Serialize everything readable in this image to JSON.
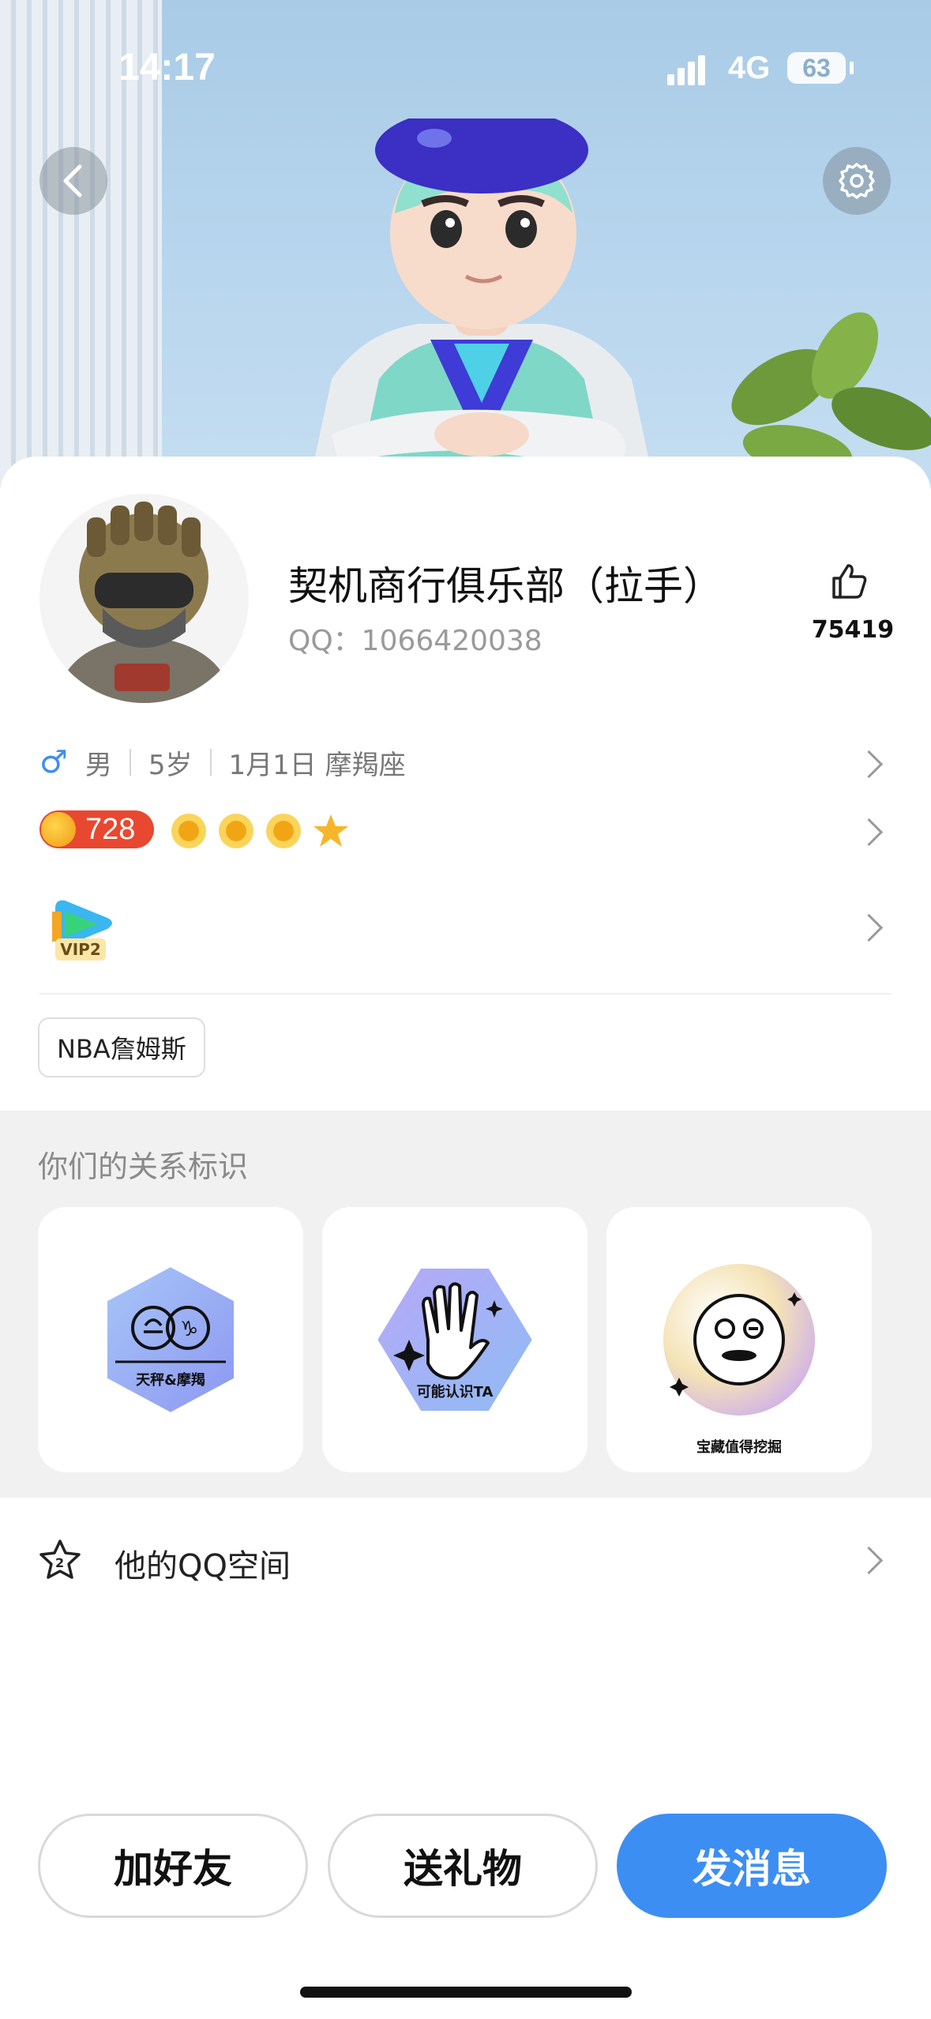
{
  "status_bar": {
    "time": "14:17",
    "network": "4G",
    "battery": "63"
  },
  "profile": {
    "name": "契机商行俱乐部（拉手）",
    "qq_label": "QQ：1066420038",
    "likes": "75419",
    "gender_symbol": "♂",
    "gender": "男",
    "age": "5岁",
    "birthday_sign": "1月1日 摩羯座",
    "level_number": "728",
    "vip_label": "VIP2",
    "tag": "NBA詹姆斯"
  },
  "relations": {
    "title": "你们的关系标识",
    "badges": [
      {
        "label": "天秤&摩羯",
        "icon": "libra-capricorn-icon"
      },
      {
        "label": "可能认识TA",
        "icon": "waving-hand-icon"
      },
      {
        "label": "宝藏值得挖掘",
        "icon": "face-icon"
      }
    ]
  },
  "qzone": {
    "label": "他的QQ空间"
  },
  "actions": {
    "add_friend": "加好友",
    "send_gift": "送礼物",
    "send_message": "发消息"
  },
  "colors": {
    "primary": "#3d8ef3",
    "male_symbol": "#3d8ef3",
    "level_badge": "#e8482f"
  }
}
